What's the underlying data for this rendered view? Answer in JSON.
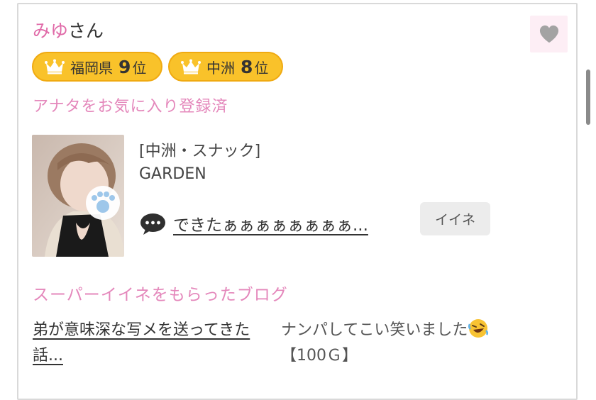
{
  "profile": {
    "name_pink": "みゆ",
    "name_suffix": "さん",
    "favorite_button_icon": "heart-icon"
  },
  "rankings": [
    {
      "region": "福岡県",
      "rank": "9",
      "suffix": "位"
    },
    {
      "region": "中洲",
      "rank": "8",
      "suffix": "位"
    }
  ],
  "favorite_status": "アナタをお気に入り登録済",
  "shop": {
    "category": "[中洲・スナック]",
    "name": "GARDEN"
  },
  "comment": {
    "text": "できたぁぁぁぁぁぁぁぁ...",
    "icon": "speech-bubble-icon",
    "iine_label": "イイネ"
  },
  "super_iine": {
    "heading": "スーパーイイネをもらったブログ",
    "blog_title": "弟が意味深な写メを送ってきた話...",
    "blog_text": "ナンパしてこい笑いました",
    "blog_price": "【100Ｇ】"
  },
  "colors": {
    "pink": "#e487bb",
    "badge_yellow": "#f9c22a",
    "badge_border": "#f0aa11",
    "fav_bg": "#fdeef5",
    "heart_gray": "#a3a3a3"
  }
}
